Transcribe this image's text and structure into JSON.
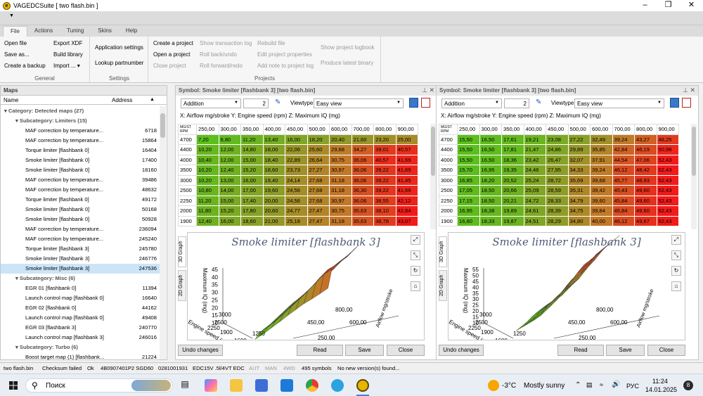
{
  "window": {
    "title": "VAGEDCSuite [ two flash.bin ]",
    "app_icon_letter": "e"
  },
  "tabs": [
    "File",
    "Actions",
    "Tuning",
    "Skins",
    "Help"
  ],
  "ribbon": {
    "general": {
      "label": "General",
      "items": [
        "Open file",
        "Save as...",
        "Create a backup",
        "Export XDF",
        "Build library",
        "Import ... ▾"
      ]
    },
    "settings": {
      "label": "Settings",
      "items": [
        "Application settings",
        "Lookup partnumber"
      ]
    },
    "projects": {
      "label": "Projects",
      "items": [
        "Create a project",
        "Open a project",
        "Close project",
        "Show transaction log",
        "Roll back/undo",
        "Roll forward/redo",
        "Rebuild file",
        "Edit project properties",
        "Add note to project log",
        "Show project logbook",
        "Produce latest binary"
      ]
    }
  },
  "maps": {
    "title": "Maps",
    "col_name": "Name",
    "col_address": "Address",
    "rows": [
      {
        "kind": "cat",
        "name": "Category: Detected maps (27)"
      },
      {
        "kind": "sub",
        "name": "Subcategory: Limiters (15)"
      },
      {
        "kind": "item",
        "name": "MAF correction by temperature...",
        "address": "6718"
      },
      {
        "kind": "item",
        "name": "MAF correction by temperature...",
        "address": "15864"
      },
      {
        "kind": "item",
        "name": "Torque limiter [flashbank 0]",
        "address": "16404"
      },
      {
        "kind": "item",
        "name": "Smoke limiter [flashbank 0]",
        "address": "17400"
      },
      {
        "kind": "item",
        "name": "Smoke limiter [flashbank 0]",
        "address": "18160"
      },
      {
        "kind": "item",
        "name": "MAF correction by temperature...",
        "address": "39486"
      },
      {
        "kind": "item",
        "name": "MAF correction by temperature...",
        "address": "48632"
      },
      {
        "kind": "item",
        "name": "Torque limiter [flashbank 0]",
        "address": "49172"
      },
      {
        "kind": "item",
        "name": "Smoke limiter [flashbank 0]",
        "address": "50168"
      },
      {
        "kind": "item",
        "name": "Smoke limiter [flashbank 0]",
        "address": "50928"
      },
      {
        "kind": "item",
        "name": "MAF correction by temperature...",
        "address": "236094"
      },
      {
        "kind": "item",
        "name": "MAF correction by temperature...",
        "address": "245240"
      },
      {
        "kind": "item",
        "name": "Torque limiter [flashbank 3]",
        "address": "245780"
      },
      {
        "kind": "item",
        "name": "Smoke limiter [flashbank 3]",
        "address": "246776"
      },
      {
        "kind": "item",
        "name": "Smoke limiter [flashbank 3]",
        "address": "247536",
        "selected": true
      },
      {
        "kind": "sub",
        "name": "Subcategory: Misc (6)"
      },
      {
        "kind": "item",
        "name": "EGR 01 [flashbank 0]",
        "address": "11394"
      },
      {
        "kind": "item",
        "name": "Launch control map [flashbank 0]",
        "address": "16640"
      },
      {
        "kind": "item",
        "name": "EGR 02 [flashbank 0]",
        "address": "44162"
      },
      {
        "kind": "item",
        "name": "Launch control map [flashbank 0]",
        "address": "49408"
      },
      {
        "kind": "item",
        "name": "EGR 03 [flashbank 3]",
        "address": "240770"
      },
      {
        "kind": "item",
        "name": "Launch control map [flashbank 3]",
        "address": "246016"
      },
      {
        "kind": "sub",
        "name": "Subcategory: Turbo (6)"
      },
      {
        "kind": "item",
        "name": "Boost target map (1) [flashbank...",
        "address": "21224"
      }
    ]
  },
  "panels": [
    {
      "title": "Symbol: Smoke limiter [flashbank 3] [two flash.bin]",
      "mode": "Addition",
      "value": "2",
      "viewtype_label": "Viewtype",
      "viewtype": "Easy view",
      "axes": "X: Airflow mg/stroke Y: Engine speed (rpm) Z: Maximum IQ (mg)",
      "corner_top": "MG/ST",
      "corner_bottom": "RPM",
      "cols": [
        "250,00",
        "300,00",
        "350,00",
        "400,00",
        "450,00",
        "500,00",
        "600,00",
        "700,00",
        "800,00",
        "900,00"
      ],
      "rows": [
        {
          "rpm": "4700",
          "v": [
            "7,20",
            "8,80",
            "11,20",
            "13,40",
            "16,00",
            "18,20",
            "20,40",
            "21,60",
            "23,20",
            "25,00"
          ]
        },
        {
          "rpm": "4400",
          "v": [
            "10,20",
            "12,00",
            "14,80",
            "18,00",
            "22,06",
            "25,60",
            "29,68",
            "34,27",
            "39,01",
            "40,57"
          ]
        },
        {
          "rpm": "4000",
          "v": [
            "10,40",
            "12,00",
            "15,00",
            "18,40",
            "22,89",
            "26,64",
            "30,75",
            "36,06",
            "40,57",
            "41,69"
          ]
        },
        {
          "rpm": "3500",
          "v": [
            "10,20",
            "12,40",
            "15,20",
            "18,60",
            "23,73",
            "27,27",
            "30,97",
            "36,06",
            "39,22",
            "41,69"
          ]
        },
        {
          "rpm": "3000",
          "v": [
            "10,20",
            "13,00",
            "16,00",
            "19,40",
            "24,14",
            "27,68",
            "31,18",
            "36,06",
            "39,22",
            "41,45"
          ]
        },
        {
          "rpm": "2500",
          "v": [
            "10,80",
            "14,00",
            "17,00",
            "19,60",
            "24,56",
            "27,68",
            "31,18",
            "36,30",
            "39,22",
            "41,69"
          ]
        },
        {
          "rpm": "2250",
          "v": [
            "11,20",
            "15,00",
            "17,40",
            "20,00",
            "24,56",
            "27,68",
            "30,97",
            "36,06",
            "38,55",
            "42,12"
          ]
        },
        {
          "rpm": "2000",
          "v": [
            "11,80",
            "15,20",
            "17,80",
            "20,60",
            "24,77",
            "27,47",
            "30,75",
            "35,63",
            "38,10",
            "42,84"
          ]
        },
        {
          "rpm": "1900",
          "v": [
            "12,40",
            "16,00",
            "18,60",
            "21,00",
            "25,18",
            "27,47",
            "31,18",
            "35,63",
            "38,78",
            "43,07"
          ]
        }
      ],
      "graph_title": "Smoke limiter [flashbank 3]",
      "tab_3d": "3D Graph",
      "tab_2d": "2D Graph",
      "z_ticks": [
        "45",
        "40",
        "35",
        "30",
        "25",
        "20",
        "15",
        "10"
      ],
      "z_label": "Maximum IQ (mg)",
      "y_ticks": [
        "3000",
        "2500",
        "2250",
        "1900",
        "1250",
        "1600"
      ],
      "y_label": "Engine speed (rpm)",
      "x_ticks": [
        "800,00",
        "450,00",
        "600,00",
        "250,00"
      ],
      "x_label": "Airflow mg/stroke",
      "buttons": {
        "undo": "Undo changes",
        "read": "Read",
        "save": "Save",
        "close": "Close"
      }
    },
    {
      "title": "Symbol: Smoke limiter [flashbank 3] [two flash.bin]",
      "mode": "Addition",
      "value": "2",
      "viewtype_label": "Viewtype",
      "viewtype": "Easy view",
      "axes": "X: Airflow mg/stroke Y: Engine speed (rpm) Z: Maximum IQ (mg)",
      "corner_top": "MG/ST",
      "corner_bottom": "RPM",
      "cols": [
        "250,00",
        "300,00",
        "350,00",
        "400,00",
        "450,00",
        "500,00",
        "600,00",
        "700,00",
        "800,00",
        "900,00"
      ],
      "rows": [
        {
          "rpm": "4700",
          "v": [
            "15,50",
            "16,50",
            "17,61",
            "19,21",
            "23,08",
            "27,22",
            "32,49",
            "39,24",
            "43,27",
            "48,25"
          ]
        },
        {
          "rpm": "4400",
          "v": [
            "15,50",
            "16,50",
            "17,81",
            "21,47",
            "24,86",
            "29,89",
            "35,85",
            "42,84",
            "46,19",
            "50,98"
          ]
        },
        {
          "rpm": "4000",
          "v": [
            "15,50",
            "16,50",
            "18,36",
            "23,42",
            "26,47",
            "32,07",
            "37,91",
            "44,54",
            "47,06",
            "52,43"
          ]
        },
        {
          "rpm": "3500",
          "v": [
            "15,70",
            "16,95",
            "19,35",
            "24,46",
            "27,95",
            "34,33",
            "39,24",
            "46,12",
            "48,42",
            "52,43"
          ]
        },
        {
          "rpm": "3000",
          "v": [
            "16,85",
            "18,20",
            "20,52",
            "25,24",
            "28,72",
            "35,69",
            "39,68",
            "45,77",
            "48,93",
            "52,43"
          ]
        },
        {
          "rpm": "2500",
          "v": [
            "17,05",
            "18,50",
            "20,66",
            "25,09",
            "28,59",
            "35,31",
            "39,42",
            "45,43",
            "49,60",
            "52,43"
          ]
        },
        {
          "rpm": "2250",
          "v": [
            "17,15",
            "18,50",
            "20,21",
            "24,72",
            "28,33",
            "34,79",
            "39,60",
            "45,84",
            "49,60",
            "52,43"
          ]
        },
        {
          "rpm": "2000",
          "v": [
            "16,95",
            "18,38",
            "19,89",
            "24,61",
            "28,39",
            "34,75",
            "39,84",
            "45,84",
            "49,60",
            "52,43"
          ]
        },
        {
          "rpm": "1900",
          "v": [
            "16,80",
            "18,33",
            "19,87",
            "24,51",
            "28,29",
            "34,80",
            "40,00",
            "46,12",
            "49,67",
            "52,43"
          ]
        }
      ],
      "graph_title": "Smoke limiter [flashbank 3]",
      "tab_3d": "3D Graph",
      "tab_2d": "2D Graph",
      "z_ticks": [
        "55",
        "50",
        "45",
        "40",
        "35",
        "30",
        "25",
        "20",
        "15",
        "10"
      ],
      "z_label": "Maximum IQ (mg)",
      "y_ticks": [
        "3000",
        "2500",
        "2250",
        "1900",
        "1250",
        "1600"
      ],
      "y_label": "Engine speed (rpm)",
      "x_ticks": [
        "800,00",
        "450,00",
        "600,00",
        "250,00"
      ],
      "x_label": "Airflow mg/stroke",
      "buttons": {
        "undo": "Undo changes",
        "read": "Read",
        "save": "Save",
        "close": "Close"
      }
    }
  ],
  "status": {
    "file": "two flash.bin",
    "checksum": "Checksum failed",
    "ok": "Ok",
    "parts": "4B0907401P2 SGD60",
    "hw": "0281001931",
    "ecu": "EDC15V .5l/4VT EDC",
    "aut": "AUT",
    "man": "MAN",
    "wd": "4WD",
    "symbols": "495 symbols",
    "version": "No new version(s) found..."
  },
  "taskbar": {
    "search": "Поиск",
    "temp": "-3°C",
    "weather": "Mostly sunny",
    "lang": "РУС",
    "time": "11:24",
    "date": "14.01.2025",
    "badge": "8"
  },
  "colors": {
    "green": "#5bbf1c",
    "red": "#f21a1a"
  }
}
